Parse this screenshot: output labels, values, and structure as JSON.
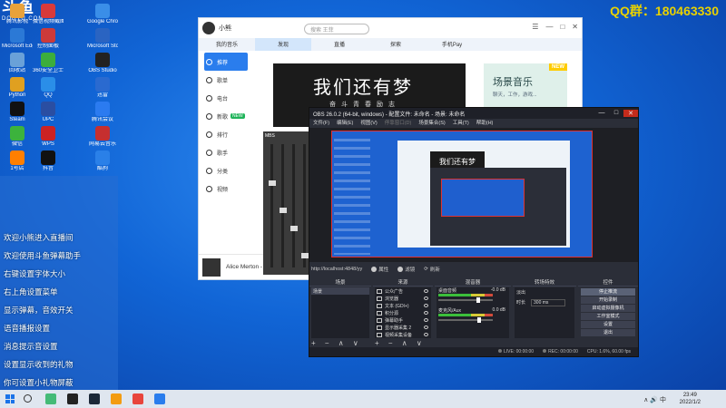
{
  "watermark": {
    "logo": "斗鱼",
    "sub": "DOUYU.COM",
    "qq": "QQ群：180463330"
  },
  "desktop_icons": [
    {
      "label": "腾讯影视",
      "color": "#e9a23b"
    },
    {
      "label": "微信视频截图",
      "color": "#d83a3a"
    },
    {
      "label": "Google Chrome",
      "color": "#3a8ee8"
    },
    {
      "label": "Microsoft Edge",
      "color": "#2b79d6"
    },
    {
      "label": "控制面板",
      "color": "#cc3a3a"
    },
    {
      "label": "Microsoft Store",
      "color": "#2a64c2"
    },
    {
      "label": "回收站",
      "color": "#6aa1d8"
    },
    {
      "label": "360安全卫士",
      "color": "#3cae3c"
    },
    {
      "label": "OBS Studio",
      "color": "#222"
    },
    {
      "label": "Python",
      "color": "#e0a020"
    },
    {
      "label": "QQ",
      "color": "#2a8ee8"
    },
    {
      "label": "迅雷",
      "color": "#2a6ad0"
    },
    {
      "label": "Steam",
      "color": "#111"
    },
    {
      "label": "UPC",
      "color": "#2a4ea2"
    },
    {
      "label": "腾讯会议",
      "color": "#2b7bf0"
    },
    {
      "label": "微信",
      "color": "#3cb33c"
    },
    {
      "label": "WPS",
      "color": "#cc2222"
    },
    {
      "label": "网易云音乐",
      "color": "#c62f2f"
    },
    {
      "label": "1号店",
      "color": "#ff7f00"
    },
    {
      "label": "抖音",
      "color": "#111"
    },
    {
      "label": "酷狗",
      "color": "#2a80e8"
    }
  ],
  "chat": [
    "欢迎小熊进入直播间",
    "欢迎使用斗鱼弹幕助手",
    "右键设置字体大小",
    "右上角设置菜单",
    "显示弹幕，音效开关",
    "语音播报设置",
    "消息提示音设置",
    "设置显示收到的礼物",
    "你可设置小礼物屏蔽"
  ],
  "music_app": {
    "username": "小熊",
    "search_placeholder": "搜索 王菲",
    "controls": [
      "☰",
      "—",
      "□",
      "✕"
    ],
    "tabs": [
      "我的音乐",
      "发现",
      "直播",
      "探索",
      "手机Pay"
    ],
    "active_tab_index": 1,
    "sidebar": [
      {
        "label": "推荐",
        "active": true
      },
      {
        "label": "歌单"
      },
      {
        "label": "电台"
      },
      {
        "label": "新歌",
        "badge": "NEW"
      },
      {
        "label": "排行"
      },
      {
        "label": "歌手"
      },
      {
        "label": "分类"
      },
      {
        "label": "视频"
      }
    ],
    "banner_title": "我们还有梦",
    "banner_sub": "奋斗青春励志",
    "side_banner_title": "场景音乐",
    "side_banner_sub": "聊天，工作，游戏...",
    "side_banner_badge": "NEW",
    "now_playing": "Alice Merton - No Roots"
  },
  "mixer_label": "MBS",
  "obs": {
    "title": "OBS 26.0.2 (64-bit, windows) - 配置文件: 未命名 - 场景: 未命名",
    "menu": [
      "文件(F)",
      "编辑(E)",
      "视图(V)",
      "停靠窗口(D)",
      "场景集合(S)",
      "工具(T)",
      "帮助(H)"
    ],
    "disabled_menu_index": 3,
    "preview_banner": "我们还有梦",
    "source_url": "http://localhost:4848/yy",
    "toolbar": {
      "properties": "属性",
      "filters": "滤镜",
      "refresh": "刷新"
    },
    "docks": {
      "scenes": "场景",
      "sources": "来源",
      "mixer": "混音器",
      "transitions": "转场特效",
      "controls": "控件"
    },
    "scenes": [
      "场景"
    ],
    "sources": [
      "公众广告",
      "浏览器",
      "文本 (GDI+)",
      "积分源",
      "弹幕助手",
      "显示器采集 2",
      "视频采集设备"
    ],
    "mixer_tracks": [
      {
        "name": "桌面音频",
        "db": "-0.0 dB",
        "handle": 0.7
      },
      {
        "name": "麦克风/Aux",
        "db": "0.0 dB",
        "handle": 0.72
      }
    ],
    "transition": {
      "label1": "淡出",
      "label2": "时长",
      "value": "300 ms"
    },
    "controls": [
      "停止推流",
      "开始录制",
      "启动虚拟摄像机",
      "工作室模式",
      "设置",
      "退出"
    ],
    "footer": "+ − ∧ ∨",
    "status": {
      "live": "LIVE: 00:00:00",
      "rec": "REC: 00:00:00",
      "cpu": "CPU: 1.6%, 60.00 fps"
    }
  },
  "taskbar": {
    "icons": [
      {
        "name": "search-icon",
        "color": "#333"
      },
      {
        "name": "taskview-icon",
        "color": "#4b7"
      },
      {
        "name": "obs-icon",
        "color": "#222"
      },
      {
        "name": "steam-icon",
        "color": "#1b2838"
      },
      {
        "name": "douyu-icon",
        "color": "#f39c12"
      },
      {
        "name": "chrome-icon",
        "color": "#e8453c"
      },
      {
        "name": "app-icon",
        "color": "#2a7ded"
      }
    ],
    "tray": "∧ 🔊 中",
    "time": "23:49",
    "date": "2022/1/2"
  }
}
